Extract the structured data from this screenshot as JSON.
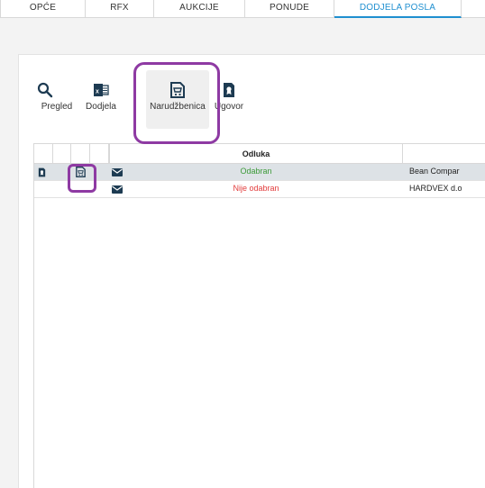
{
  "tabs": [
    {
      "label": "OPĆE"
    },
    {
      "label": "RFX"
    },
    {
      "label": "AUKCIJE"
    },
    {
      "label": "PONUDE"
    },
    {
      "label": "DODJELA POSLA"
    },
    {
      "label": ""
    }
  ],
  "toolbar": {
    "items": [
      {
        "label": "Pregled",
        "icon": "search-icon"
      },
      {
        "label": "Dodjela",
        "icon": "excel-icon"
      },
      {
        "label": "Narudžbenica",
        "icon": "purchase-order-icon"
      },
      {
        "label": "Ugovor",
        "icon": "contract-icon"
      }
    ]
  },
  "grid": {
    "columns": [
      "",
      "",
      "",
      "",
      "Odluka",
      ""
    ],
    "rows": [
      {
        "decision": "Odabran",
        "company": "Bean Compar",
        "selected": true,
        "decision_color": "#3c9a38"
      },
      {
        "decision": "Nije odabran",
        "company": "HARDVEX d.o",
        "selected": false,
        "decision_color": "#e23c3c"
      }
    ]
  },
  "colors": {
    "accent": "#1f8fd0",
    "highlight": "#8e3aa3"
  }
}
